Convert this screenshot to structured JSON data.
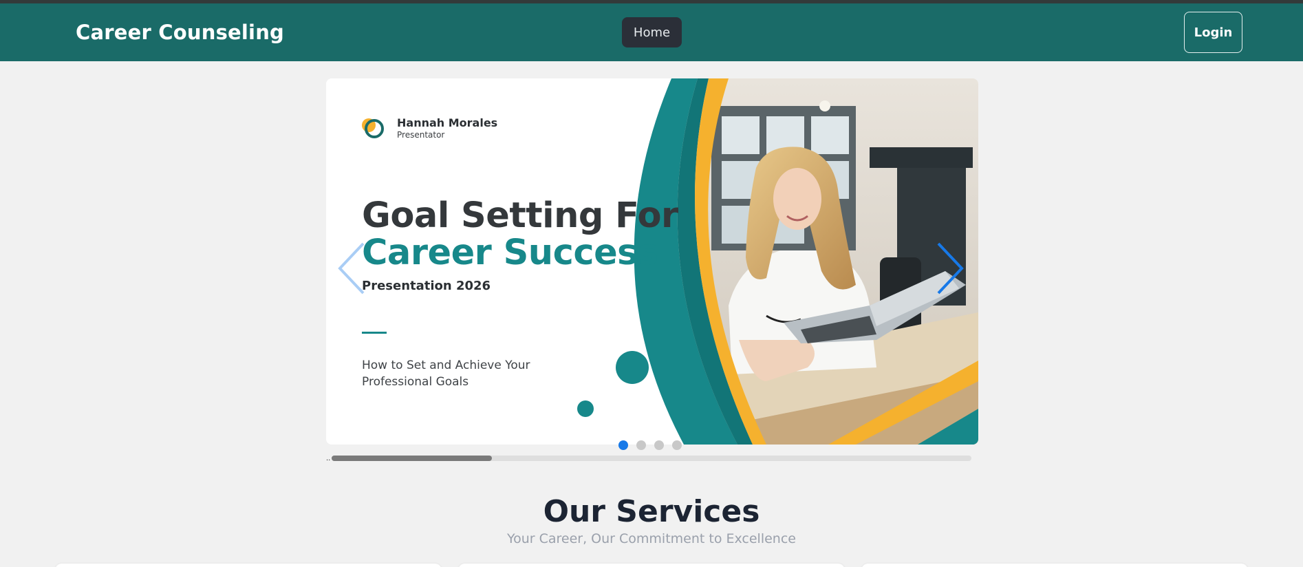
{
  "navbar": {
    "brand": "Career Counseling",
    "home_label": "Home",
    "login_label": "Login",
    "bg_color": "#1a6b68"
  },
  "carousel": {
    "slide": {
      "presenter_name": "Hannah Morales",
      "presenter_role": "Presentator",
      "title_line1": "Goal Setting For",
      "title_line2": "Career Success",
      "subtitle": "Presentation 2026",
      "description": "How to Set and Achieve Your Professional Goals",
      "accent_teal": "#17888a",
      "accent_yellow": "#f5b12e"
    },
    "prev_icon": "chevron-left-icon",
    "next_icon": "chevron-right-icon",
    "slide_count": 4,
    "active_index": 0,
    "scroll_progress": 0.25
  },
  "services": {
    "title": "Our Services",
    "subtitle": "Your Career, Our Commitment to Excellence"
  }
}
